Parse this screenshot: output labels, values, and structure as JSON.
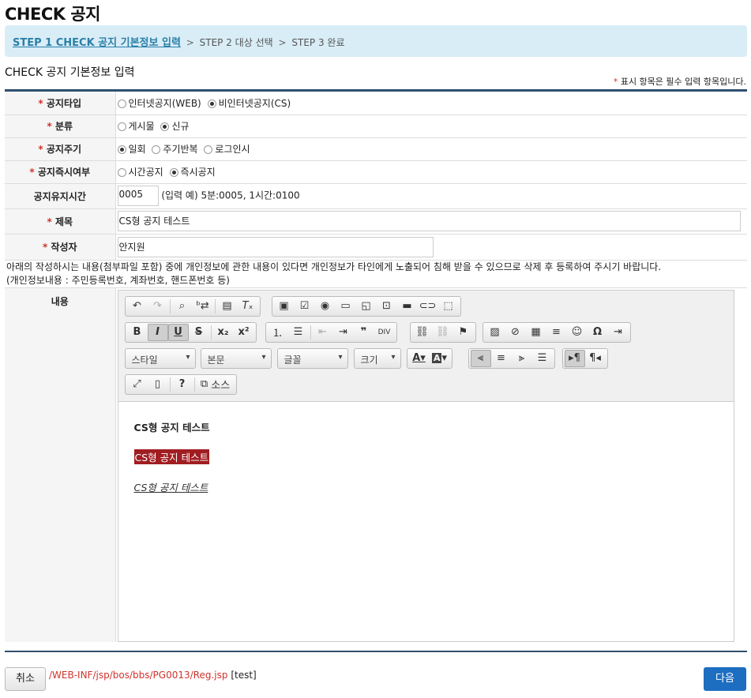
{
  "page_title": "CHECK 공지",
  "steps": [
    {
      "label": "STEP 1 CHECK 공지 기본정보 입력"
    },
    {
      "label": "STEP 2 대상 선택"
    },
    {
      "label": "STEP 3 완료"
    }
  ],
  "step_separator": ">",
  "section_title": "CHECK 공지 기본정보 입력",
  "required_note": {
    "star": "*",
    "text": " 표시 항목은 필수 입력 항목입니다."
  },
  "form": {
    "type": {
      "label": "공지타입",
      "options": [
        "인터넷공지(WEB)",
        "비인터넷공지(CS)"
      ],
      "selected": 1
    },
    "category": {
      "label": "분류",
      "options": [
        "게시물",
        "신규"
      ],
      "selected": 1
    },
    "cycle": {
      "label": "공지주기",
      "options": [
        "일회",
        "주기반복",
        "로그인시"
      ],
      "selected": 0
    },
    "immediate": {
      "label": "공지즉시여부",
      "options": [
        "시간공지",
        "즉시공지"
      ],
      "selected": 1
    },
    "duration": {
      "label": "공지유지시간",
      "value": "0005",
      "hint": "(입력 예) 5분:0005, 1시간:0100"
    },
    "subject": {
      "label": "제목",
      "value": "CS형 공지 테스트"
    },
    "author": {
      "label": "작성자",
      "value": "안지원"
    },
    "notice_line1": "아래의 작성하시는 내용(첨부파일 포함) 중에 개인정보에 관한 내용이 있다면 개인정보가 타인에게 노출되어 침해 받을 수 있으므로 삭제 후 등록하여 주시기 바랍니다.",
    "notice_line2": "(개인정보내용 : 주민등록번호, 계좌번호, 핸드폰번호 등)",
    "content_label": "내용"
  },
  "editor": {
    "combos": {
      "style": "스타일",
      "format": "본문",
      "font": "글꼴",
      "size": "크기"
    },
    "source_label": "소스",
    "lines": [
      "CS형 공지 테스트",
      "CS형 공지 테스트",
      "CS형 공지 테스트"
    ]
  },
  "footer": {
    "cancel_label": "취소",
    "next_label": "다음",
    "path": "/WEB-INF/jsp/bos/bbs/PG0013/Reg.jsp",
    "path_tag": "[test]"
  }
}
